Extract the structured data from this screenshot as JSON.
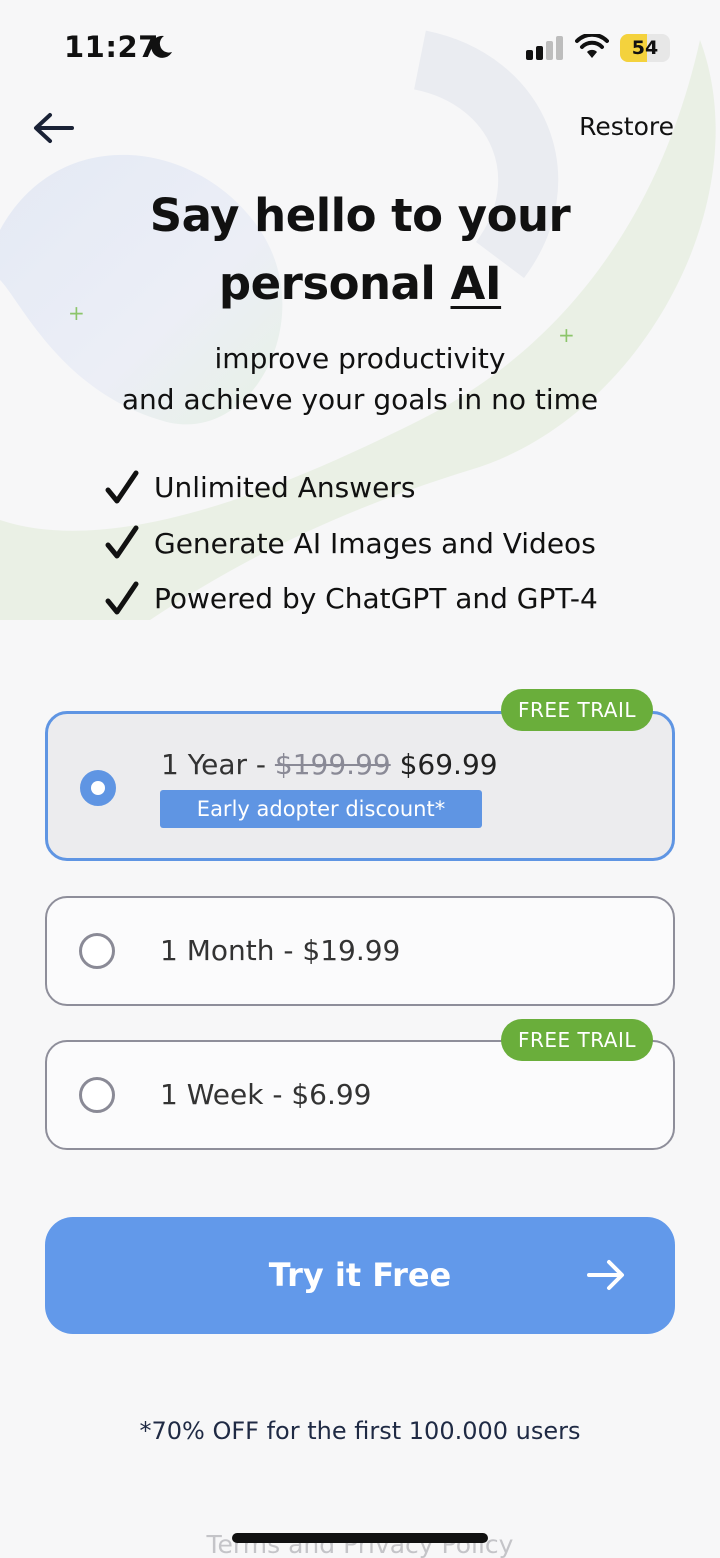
{
  "status_bar": {
    "time": "11:27",
    "battery": "54",
    "battery_level": 0.54,
    "icons": [
      "moon-icon",
      "signal-icon",
      "wifi-icon",
      "battery-icon"
    ]
  },
  "nav": {
    "back_icon": "arrow-left-icon",
    "restore_label": "Restore"
  },
  "hero": {
    "headline_line1": "Say hello to your",
    "headline_line2_prefix": "personal ",
    "headline_line2_emphasis": "AI",
    "subtitle_line1": "improve productivity",
    "subtitle_line2": "and achieve your goals in no time"
  },
  "features": [
    "Unlimited Answers",
    "Generate AI Images and Videos",
    "Powered by ChatGPT and GPT-4"
  ],
  "plans": [
    {
      "label_prefix": "1 Year - ",
      "old_price": "$199.99",
      "new_price": " $69.99",
      "discount_badge": "Early adopter discount*",
      "trial_badge": "FREE TRAIL",
      "selected": true
    },
    {
      "label": "1 Month - $19.99",
      "selected": false
    },
    {
      "label": "1 Week - $6.99",
      "trial_badge": "FREE TRAIL",
      "selected": false
    }
  ],
  "cta": {
    "label": "Try it Free",
    "icon": "arrow-right-icon"
  },
  "footnote": "*70% OFF for the first 100.000 users",
  "terms_link": "Terms and Privacy Policy",
  "colors": {
    "accent": "#6299ea",
    "selected_border": "#5f95e3",
    "trial_badge": "#6aae3b",
    "battery": "#f4d23d"
  }
}
